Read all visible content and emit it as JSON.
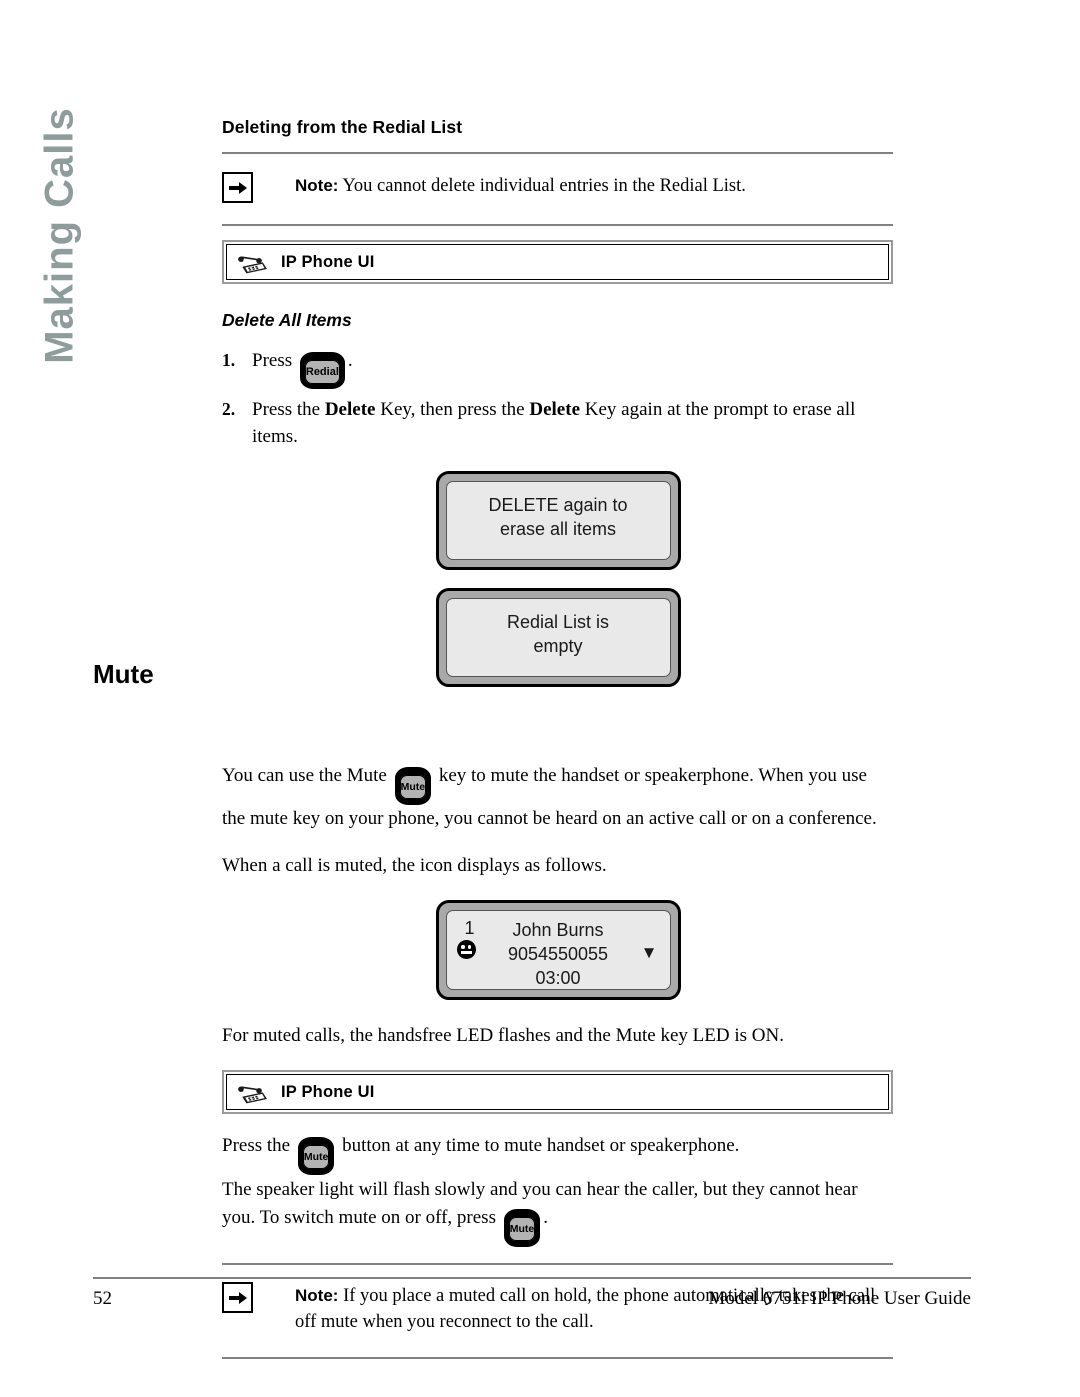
{
  "side_tab": {
    "label": "Making Calls"
  },
  "section": {
    "heading": "Deleting from the Redial List",
    "note1": {
      "label": "Note:",
      "text": " You cannot delete individual entries in the Redial List."
    },
    "ui_bar_1": {
      "label": "IP Phone UI",
      "icon": "ip-phone-icon"
    },
    "sub_heading": "Delete All Items",
    "steps": [
      {
        "num": "1.",
        "text_before": "Press",
        "key": "Redial",
        "text_after": "."
      },
      {
        "num": "2.",
        "text_parts": [
          "Press the ",
          "Delete",
          " Key, then press the ",
          "Delete",
          " Key again at the prompt to erase all items."
        ]
      }
    ],
    "lcd_delete_prompt": {
      "line1": "DELETE again to",
      "line2": "erase all items"
    },
    "lcd_empty": {
      "line1": "Redial List is",
      "line2": "empty"
    }
  },
  "mute_section": {
    "heading": "Mute",
    "para1_before": "You can use the Mute",
    "para1_key": "Mute",
    "para1_after": "key to mute the handset or speakerphone. When you use the mute key on your phone, you cannot be heard on an active call or on a conference.",
    "para2": "When a call is muted, the icon displays as follows.",
    "lcd_call": {
      "line_number": "1",
      "caller_name": "John Burns",
      "caller_number": "9054550055",
      "down_arrow": "▼",
      "duration": "03:00",
      "mute_icon": "mute-face-icon"
    },
    "para3": "For muted calls, the handsfree LED flashes and the Mute key LED is ON.",
    "ui_bar_2": {
      "label": "IP Phone UI",
      "icon": "ip-phone-icon"
    },
    "press_before": "Press the",
    "press_key": "Mute",
    "press_after": "button at any time to mute handset or speakerphone.",
    "speaker_line": "The speaker light will flash slowly and you can hear the caller, but they cannot hear you. To switch mute on or off, press",
    "speaker_key": "Mute",
    "speaker_after": ".",
    "note2": {
      "label": "Note:",
      "text": " If you place a muted call on hold, the phone automatically takes the call off mute when you reconnect to the call."
    }
  },
  "footer": {
    "page_number": "52",
    "guide_title": "Model 6751i IP Phone User Guide"
  },
  "colors": {
    "side_tab": "#8e9d9c",
    "rule": "#808080",
    "lcd_bezel": "#a9a9a9",
    "lcd_screen": "#e9e9e9",
    "key_face": "#b3b3b3"
  }
}
